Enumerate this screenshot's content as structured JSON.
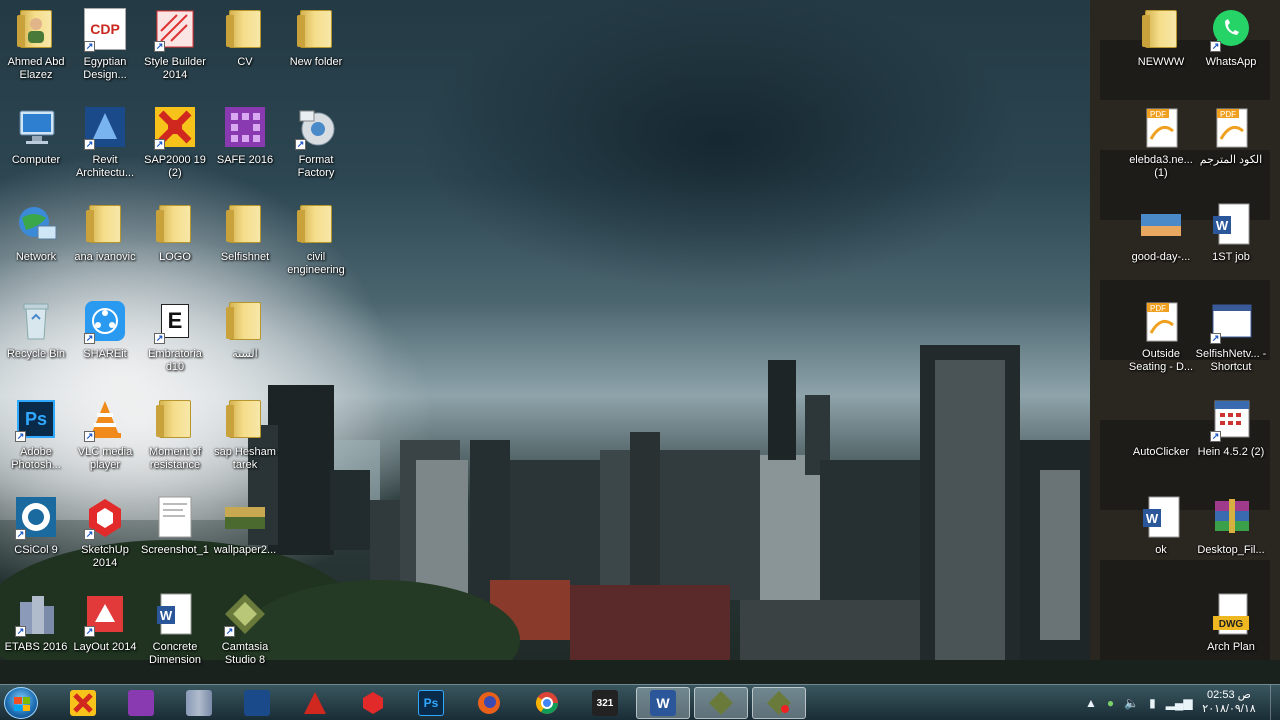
{
  "desktop": {
    "icons": [
      {
        "label": "Ahmed Abd Elazez",
        "icon": "user-folder-icon"
      },
      {
        "label": "Egyptian Design...",
        "icon": "cdp-app-icon"
      },
      {
        "label": "Style Builder 2014",
        "icon": "style-builder-icon"
      },
      {
        "label": "CV",
        "icon": "folder-icon"
      },
      {
        "label": "New folder",
        "icon": "folder-icon"
      },
      {
        "label": "Computer",
        "icon": "computer-icon"
      },
      {
        "label": "Revit Architectu...",
        "icon": "revit-icon"
      },
      {
        "label": "SAP2000 19 (2)",
        "icon": "sap2000-icon"
      },
      {
        "label": "SAFE 2016",
        "icon": "safe-icon"
      },
      {
        "label": "Format Factory",
        "icon": "format-factory-icon"
      },
      {
        "label": "Network",
        "icon": "network-icon"
      },
      {
        "label": "ana ivanovic",
        "icon": "folder-icon"
      },
      {
        "label": "LOGO",
        "icon": "folder-icon"
      },
      {
        "label": "Selfishnet",
        "icon": "folder-icon"
      },
      {
        "label": "civil engineering",
        "icon": "folder-icon"
      },
      {
        "label": "Recycle Bin",
        "icon": "recycle-bin-icon"
      },
      {
        "label": "SHAREit",
        "icon": "shareit-icon"
      },
      {
        "label": "Embratoria d10",
        "icon": "embratoria-icon"
      },
      {
        "label": "الستة",
        "icon": "folder-icon"
      },
      {
        "label": "Adobe Photosh...",
        "icon": "photoshop-icon"
      },
      {
        "label": "VLC media player",
        "icon": "vlc-icon"
      },
      {
        "label": "Moment of resistance",
        "icon": "folder-icon"
      },
      {
        "label": "sap Hesham tarek",
        "icon": "folder-icon"
      },
      {
        "label": "CSiCol 9",
        "icon": "csicol-icon"
      },
      {
        "label": "SketchUp 2014",
        "icon": "sketchup-icon"
      },
      {
        "label": "Screenshot_1",
        "icon": "image-file-icon"
      },
      {
        "label": "wallpaper2...",
        "icon": "image-file-icon"
      },
      {
        "label": "ETABS 2016",
        "icon": "etabs-icon"
      },
      {
        "label": "LayOut 2014",
        "icon": "layout-icon"
      },
      {
        "label": "Concrete Dimension",
        "icon": "word-doc-icon"
      },
      {
        "label": "Camtasia Studio 8",
        "icon": "camtasia-icon"
      },
      {
        "label": "NEWWW",
        "icon": "folder-icon"
      },
      {
        "label": "WhatsApp",
        "icon": "whatsapp-icon"
      },
      {
        "label": "elebda3.ne... (1)",
        "icon": "pdf-icon"
      },
      {
        "label": "الكود المترجم",
        "icon": "pdf-icon"
      },
      {
        "label": "good-day-...",
        "icon": "image-file-icon"
      },
      {
        "label": "1ST job",
        "icon": "word-doc-icon"
      },
      {
        "label": "Outside Seating - D...",
        "icon": "pdf-icon"
      },
      {
        "label": "SelfishNetv... - Shortcut",
        "icon": "app-window-icon"
      },
      {
        "label": "AutoClicker",
        "icon": "autoclicker-icon"
      },
      {
        "label": "Hein 4.5.2 (2)",
        "icon": "calendar-app-icon"
      },
      {
        "label": "ok",
        "icon": "word-doc-icon"
      },
      {
        "label": "Desktop_Fil...",
        "icon": "winrar-icon"
      },
      {
        "label": "Arch Plan",
        "icon": "dwg-file-icon"
      }
    ]
  },
  "taskbar": {
    "start_label": "Start",
    "pinned": [
      {
        "name": "sap2000-icon",
        "text": ""
      },
      {
        "name": "safe-icon",
        "text": ""
      },
      {
        "name": "etabs-icon",
        "text": ""
      },
      {
        "name": "revit-icon",
        "text": ""
      },
      {
        "name": "autocad-icon",
        "text": ""
      },
      {
        "name": "sketchup-icon",
        "text": ""
      },
      {
        "name": "photoshop-icon",
        "text": "Ps"
      },
      {
        "name": "firefox-icon",
        "text": ""
      },
      {
        "name": "chrome-icon",
        "text": ""
      },
      {
        "name": "media-player-321-icon",
        "text": "321"
      },
      {
        "name": "word-icon",
        "text": "W"
      },
      {
        "name": "camtasia-icon",
        "text": ""
      },
      {
        "name": "camtasia-recorder-icon",
        "text": ""
      }
    ],
    "clock": {
      "time": "02:53 ص",
      "date": "٢٠١٨/٠٩/١٨"
    }
  },
  "colors": {
    "taskbar": "#2a4a56",
    "label_text": "#ffffff",
    "sky_dark": "#243a44"
  }
}
